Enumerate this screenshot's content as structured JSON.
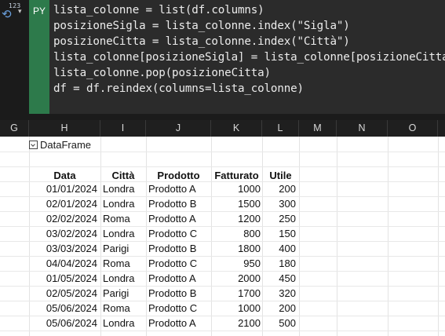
{
  "editor": {
    "badge": "PY",
    "type_icon_sup": "123",
    "lines": [
      "lista_colonne = list(df.columns)",
      "posizioneSigla = lista_colonne.index(\"Sigla\")",
      "posizioneCitta = lista_colonne.index(\"Città\")",
      "lista_colonne[posizioneSigla] = lista_colonne[posizioneCitta]",
      "lista_colonne.pop(posizioneCitta)",
      "df = df.reindex(columns=lista_colonne)"
    ]
  },
  "columns": [
    "G",
    "H",
    "I",
    "J",
    "K",
    "L",
    "M",
    "N",
    "O"
  ],
  "dataframe_label": "DataFrame",
  "table": {
    "headers": [
      "Data",
      "Città",
      "Prodotto",
      "Fatturato",
      "Utile"
    ],
    "rows": [
      [
        "01/01/2024",
        "Londra",
        "Prodotto A",
        "1000",
        "200"
      ],
      [
        "02/01/2024",
        "Londra",
        "Prodotto B",
        "1500",
        "300"
      ],
      [
        "02/02/2024",
        "Roma",
        "Prodotto A",
        "1200",
        "250"
      ],
      [
        "03/02/2024",
        "Londra",
        "Prodotto C",
        "800",
        "150"
      ],
      [
        "03/03/2024",
        "Parigi",
        "Prodotto B",
        "1800",
        "400"
      ],
      [
        "04/04/2024",
        "Roma",
        "Prodotto C",
        "950",
        "180"
      ],
      [
        "01/05/2024",
        "Londra",
        "Prodotto A",
        "2000",
        "450"
      ],
      [
        "02/05/2024",
        "Parigi",
        "Prodotto B",
        "1700",
        "320"
      ],
      [
        "05/06/2024",
        "Roma",
        "Prodotto C",
        "1000",
        "200"
      ],
      [
        "05/06/2024",
        "Londra",
        "Prodotto A",
        "2100",
        "500"
      ]
    ]
  }
}
